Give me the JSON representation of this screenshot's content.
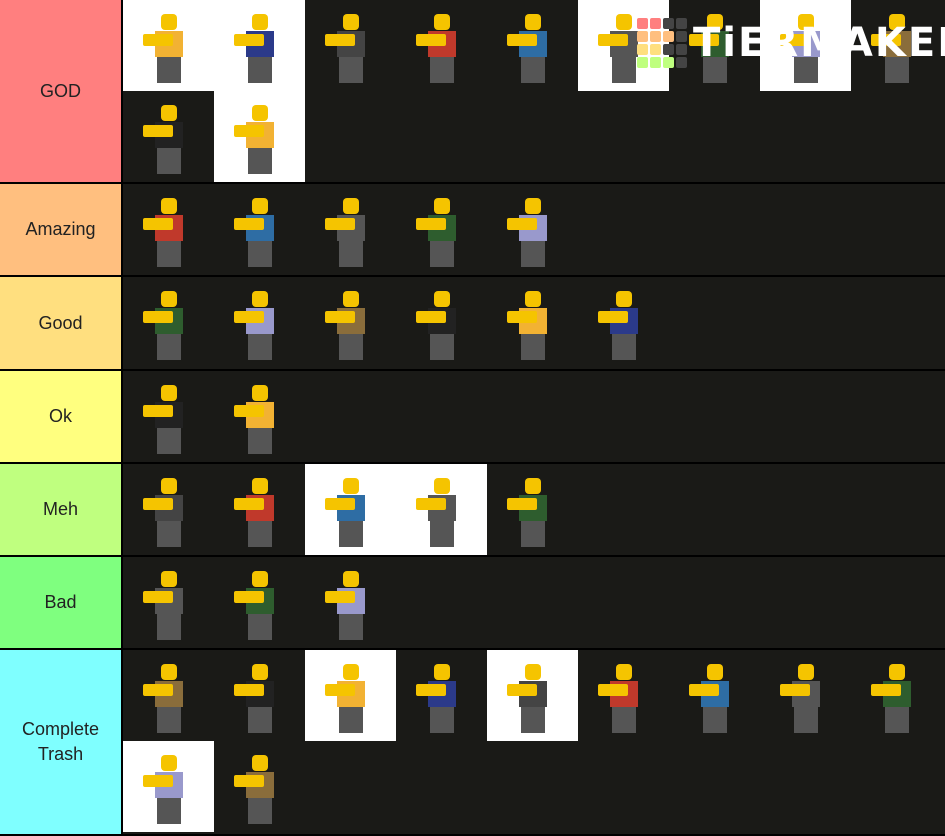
{
  "brand": {
    "logo_text": "TiERMAKER",
    "logo_colors": [
      "#ff7f7f",
      "#ffbf7f",
      "#ffdf7f",
      "#bfff7f",
      "#7fff7f"
    ]
  },
  "tiers": [
    {
      "label": "GOD",
      "color": "#ff7f7f",
      "items": [
        "white",
        "white",
        "dark",
        "dark",
        "dark",
        "white",
        "dark",
        "white",
        "dark",
        "dark",
        "white"
      ]
    },
    {
      "label": "Amazing",
      "color": "#ffbf7f",
      "items": [
        "dark",
        "dark",
        "dark",
        "dark",
        "dark"
      ]
    },
    {
      "label": "Good",
      "color": "#ffdf7f",
      "items": [
        "dark",
        "dark",
        "dark",
        "dark",
        "dark",
        "dark"
      ]
    },
    {
      "label": "Ok",
      "color": "#ffff7f",
      "items": [
        "dark",
        "dark"
      ]
    },
    {
      "label": "Meh",
      "color": "#bfff7f",
      "items": [
        "dark",
        "dark",
        "white",
        "white",
        "dark"
      ]
    },
    {
      "label": "Bad",
      "color": "#7fff7f",
      "items": [
        "dark",
        "dark",
        "dark"
      ]
    },
    {
      "label": "Complete Trash",
      "color": "#7fffff",
      "items": [
        "dark",
        "dark",
        "white",
        "dark",
        "white",
        "dark",
        "dark",
        "dark",
        "dark",
        "white",
        "dark"
      ]
    }
  ]
}
